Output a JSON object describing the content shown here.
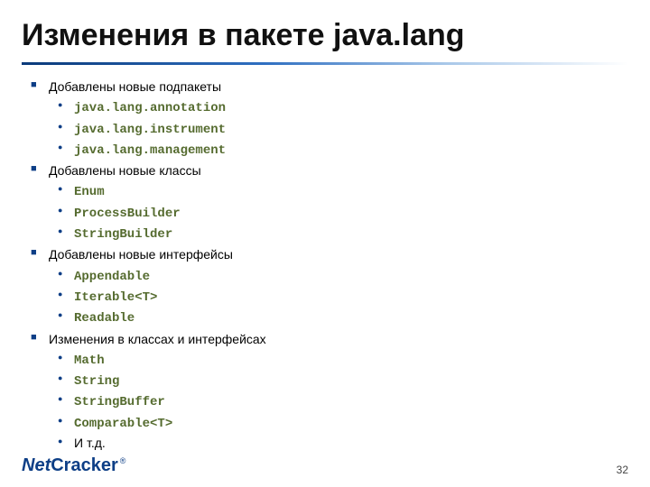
{
  "title": "Изменения в пакете java.lang",
  "sections": [
    {
      "heading": "Добавлены новые подпакеты",
      "items": [
        {
          "text": "java.lang.annotation",
          "code": true
        },
        {
          "text": "java.lang.instrument",
          "code": true
        },
        {
          "text": "java.lang.management",
          "code": true
        }
      ]
    },
    {
      "heading": "Добавлены новые классы",
      "items": [
        {
          "text": "Enum",
          "code": true
        },
        {
          "text": "ProcessBuilder",
          "code": true
        },
        {
          "text": "StringBuilder",
          "code": true
        }
      ]
    },
    {
      "heading": "Добавлены новые интерфейсы",
      "items": [
        {
          "text": "Appendable",
          "code": true
        },
        {
          "text": "Iterable<T>",
          "code": true
        },
        {
          "text": "Readable",
          "code": true
        }
      ]
    },
    {
      "heading": "Изменения в классах и интерфейсах",
      "items": [
        {
          "text": "Math",
          "code": true
        },
        {
          "text": "String",
          "code": true
        },
        {
          "text": "StringBuffer",
          "code": true
        },
        {
          "text": "Comparable<T>",
          "code": true
        },
        {
          "text": "И т.д.",
          "code": false
        }
      ]
    }
  ],
  "footer": {
    "logo_net": "Net",
    "logo_cracker": "Cracker",
    "logo_reg": "®",
    "page_number": "32"
  }
}
